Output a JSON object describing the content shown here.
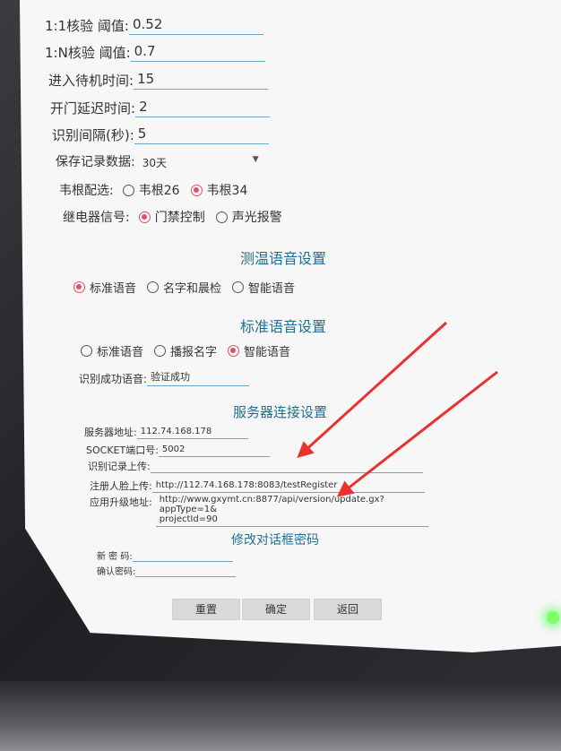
{
  "settings": {
    "threshold_11": {
      "label": "1:1核验 阈值:",
      "value": "0.52"
    },
    "threshold_1n": {
      "label": "1:N核验 阈值:",
      "value": "0.7"
    },
    "standby_time": {
      "label": "进入待机时间:",
      "value": "15"
    },
    "door_delay": {
      "label": "开门延迟时间:",
      "value": "2"
    },
    "recog_interval": {
      "label": "识别间隔(秒):",
      "value": "5"
    },
    "record_retention": {
      "label": "保存记录数据:",
      "value": "30天"
    },
    "wiegand": {
      "label": "韦根配选:",
      "options": [
        "韦根26",
        "韦根34"
      ],
      "selected": "韦根34"
    },
    "relay": {
      "label": "继电器信号:",
      "options": [
        "门禁控制",
        "声光报警"
      ],
      "selected": "门禁控制"
    }
  },
  "temp_voice": {
    "title": "测温语音设置",
    "options": [
      "标准语音",
      "名字和晨检",
      "智能语音"
    ],
    "selected": "标准语音"
  },
  "standard_voice": {
    "title": "标准语音设置",
    "options": [
      "标准语音",
      "播报名字",
      "智能语音"
    ],
    "selected": "智能语音",
    "success_label": "识别成功语音:",
    "success_value": "验证成功"
  },
  "server": {
    "title": "服务器连接设置",
    "address_label": "服务器地址:",
    "address_value": "112.74.168.178",
    "socket_label": "SOCKET端口号:",
    "socket_value": "5002",
    "record_upload_label": "识别记录上传:",
    "record_upload_value": "",
    "face_upload_label": "注册人脸上传:",
    "face_upload_value": "http://112.74.168.178:8083/testRegister",
    "upgrade_label": "应用升级地址:",
    "upgrade_value_line1": "http://www.gxymt.cn:8877/api/version/update.gx?appType=1&",
    "upgrade_value_line2": "projectId=90"
  },
  "password": {
    "title": "修改对话框密码",
    "new_label": "新 密 码:",
    "new_value": "",
    "confirm_label": "确认密码:",
    "confirm_value": ""
  },
  "buttons": {
    "reset": "重置",
    "confirm": "确定",
    "back": "返回"
  },
  "colors": {
    "accent": "#1f6f8f",
    "radio_on": "#e0506a",
    "arrow": "#e8322f",
    "field_underline": "#6aa7c4"
  }
}
